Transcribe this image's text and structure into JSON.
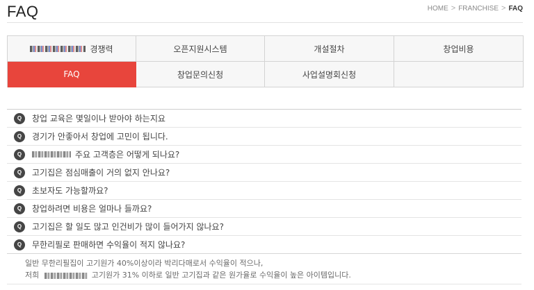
{
  "page": {
    "title": "FAQ"
  },
  "breadcrumb": {
    "home": "HOME",
    "section": "FRANCHISE",
    "current": "FAQ",
    "sep": ">"
  },
  "menu": {
    "competitiveness_suffix": "경쟁력",
    "support_system": "오픈지원시스템",
    "opening_steps": "개설절차",
    "startup_cost": "창업비용",
    "faq": "FAQ",
    "startup_inquiry": "창업문의신청",
    "briefing_apply": "사업설명회신청"
  },
  "faq": {
    "badge": "Q",
    "items": [
      {
        "question": "창업 교육은 몇일이나 받아야 하는지요"
      },
      {
        "question": "경기가 안좋아서 창업에 고민이 됩니다."
      },
      {
        "question": "주요 고객층은 어떻게 되나요?"
      },
      {
        "question": "고기집은 점심매출이 거의 없지 안나요?"
      },
      {
        "question": "초보자도 가능할까요?"
      },
      {
        "question": "창업하려면 비용은 얼마나 들까요?"
      },
      {
        "question": "고기집은 할 일도 많고 인건비가 많이 들어가지 않나요?"
      },
      {
        "question": "무한리필로 판매하면 수익율이 적지 않나요?"
      }
    ],
    "answer_line1": "일반 무한리필집이 고기원가 40%이상이라 박리다매로서 수익율이 적으나,",
    "answer_line2_prefix": "저희",
    "answer_line2_rest": "고기원가 31% 이하로 일반 고기집과 같은 원가율로 수익율이 높은 아이템입니다."
  },
  "colors": {
    "accent": "#e8453c",
    "badge": "#454545",
    "menu_bg": "#f7f7f7"
  }
}
